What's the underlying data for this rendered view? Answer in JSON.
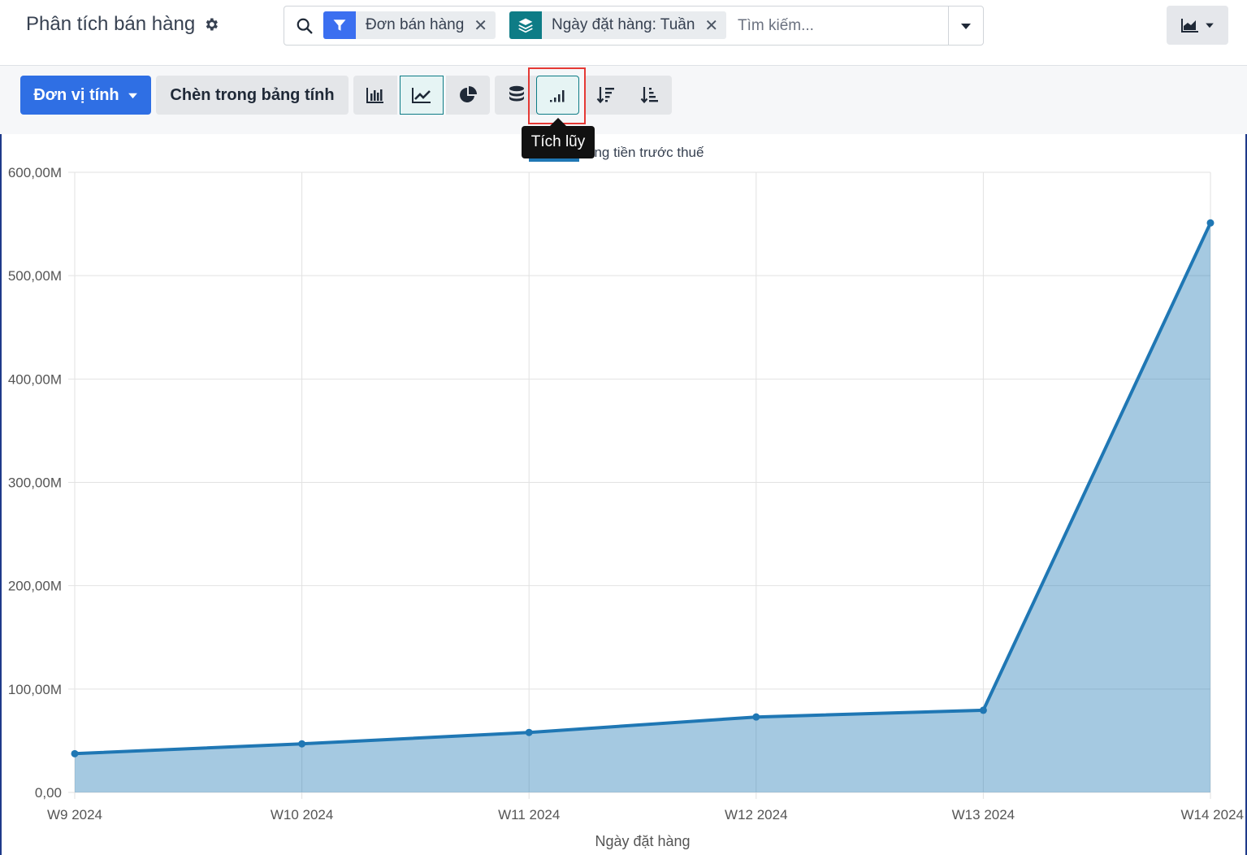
{
  "header": {
    "title": "Phân tích bán hàng",
    "search": {
      "facets": [
        {
          "label": "Đơn bán hàng",
          "icon": "filter-icon",
          "color": "#3b6ff0"
        },
        {
          "label": "Ngày đặt hàng: Tuần",
          "icon": "layers-icon",
          "color": "#0e7c86"
        }
      ],
      "placeholder": "Tìm kiếm..."
    }
  },
  "toolbar": {
    "measure_label": "Đơn vị tính",
    "insert_label": "Chèn trong bảng tính",
    "tooltip": "Tích lũy"
  },
  "chart_data": {
    "type": "area",
    "x": [
      "W9 2024",
      "W10 2024",
      "W11 2024",
      "W12 2024",
      "W13 2024",
      "W14 2024"
    ],
    "series": [
      {
        "name": "Tổng tiền trước thuế",
        "values": [
          37500000,
          47000000,
          58000000,
          73000000,
          79500000,
          551000000
        ],
        "color": "#1f77b4"
      }
    ],
    "xlabel": "Ngày đặt hàng",
    "ylabel": "",
    "ylim": [
      0,
      600000000
    ],
    "yticks": [
      "0,00",
      "100,00M",
      "200,00M",
      "300,00M",
      "400,00M",
      "500,00M",
      "600,00M"
    ],
    "legend_visible_text": "ổng tiền trước thuế",
    "legend": "top",
    "grid": true
  }
}
